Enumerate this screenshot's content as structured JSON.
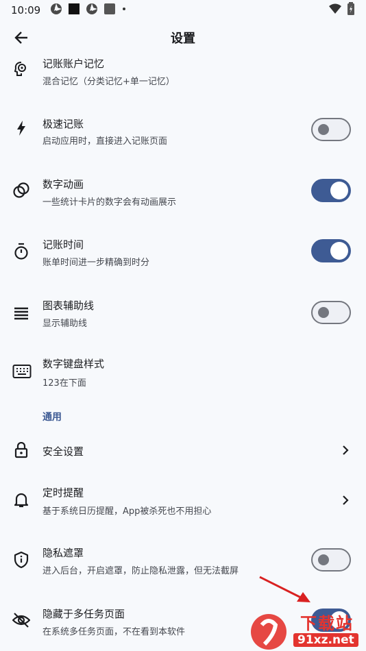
{
  "status_bar": {
    "time": "10:09"
  },
  "header": {
    "title": "设置"
  },
  "settings": [
    {
      "title": "记账账户记忆",
      "subtitle": "混合记忆（分类记忆+单一记忆）",
      "icon": "brain-icon"
    },
    {
      "title": "极速记账",
      "subtitle": "启动应用时，直接进入记账页面",
      "icon": "flash-icon",
      "toggle": false
    },
    {
      "title": "数字动画",
      "subtitle": "一些统计卡片的数字会有动画展示",
      "icon": "rings-icon",
      "toggle": true
    },
    {
      "title": "记账时间",
      "subtitle": "账单时间进一步精确到时分",
      "icon": "timer-icon",
      "toggle": true
    },
    {
      "title": "图表辅助线",
      "subtitle": "显示辅助线",
      "icon": "lines-icon",
      "toggle": false
    },
    {
      "title": "数字键盘样式",
      "subtitle": "123在下面",
      "icon": "keyboard-icon"
    }
  ],
  "general_section": {
    "label": "通用"
  },
  "general": [
    {
      "title": "安全设置",
      "icon": "lock-icon"
    },
    {
      "title": "定时提醒",
      "subtitle": "基于系统日历提醒，App被杀死也不用担心",
      "icon": "bell-icon"
    },
    {
      "title": "隐私遮罩",
      "subtitle": "进入后台，开启遮罩，防止隐私泄露，但无法截屏",
      "icon": "shield-icon",
      "toggle": false
    },
    {
      "title": "隐藏于多任务页面",
      "subtitle": "在系统多任务页面，不在看到本软件",
      "icon": "eye-off-icon",
      "toggle": true
    }
  ],
  "watermark": {
    "text": "下载站",
    "domain": "91xz.net"
  },
  "colors": {
    "accent": "#3e5b94",
    "background": "#f7f9fc"
  }
}
